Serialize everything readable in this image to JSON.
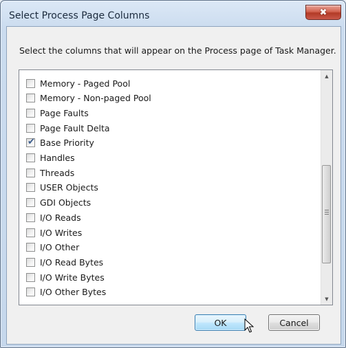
{
  "window": {
    "title": "Select Process Page Columns",
    "close_glyph": "✖"
  },
  "dialog": {
    "instruction": "Select the columns that will appear on the Process page of Task Manager."
  },
  "columns": [
    {
      "label": "Memory - Paged Pool",
      "checked": false
    },
    {
      "label": "Memory - Non-paged Pool",
      "checked": false
    },
    {
      "label": "Page Faults",
      "checked": false
    },
    {
      "label": "Page Fault Delta",
      "checked": false
    },
    {
      "label": "Base Priority",
      "checked": true
    },
    {
      "label": "Handles",
      "checked": false
    },
    {
      "label": "Threads",
      "checked": false
    },
    {
      "label": "USER Objects",
      "checked": false
    },
    {
      "label": "GDI Objects",
      "checked": false
    },
    {
      "label": "I/O Reads",
      "checked": false
    },
    {
      "label": "I/O Writes",
      "checked": false
    },
    {
      "label": "I/O Other",
      "checked": false
    },
    {
      "label": "I/O Read Bytes",
      "checked": false
    },
    {
      "label": "I/O Write Bytes",
      "checked": false
    },
    {
      "label": "I/O Other Bytes",
      "checked": false
    }
  ],
  "scrollbar": {
    "up_glyph": "▲",
    "down_glyph": "▼"
  },
  "buttons": {
    "ok": "OK",
    "cancel": "Cancel"
  },
  "checkmark_glyph": "✔",
  "icons": {
    "close": "close-icon",
    "scroll_up": "scroll-up-arrow-icon",
    "scroll_down": "scroll-down-arrow-icon",
    "cursor": "mouse-pointer-icon"
  },
  "colors": {
    "title_bar": "#cbdcef",
    "close_button": "#c9584a",
    "ok_button_border": "#3c7fb1",
    "checkmark": "#3a5b8c"
  }
}
